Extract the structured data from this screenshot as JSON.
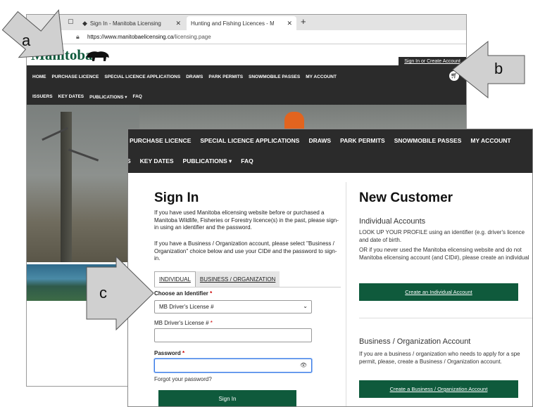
{
  "browser": {
    "tabs": [
      {
        "label": "Sign In - Manitoba Licensing",
        "active": false
      },
      {
        "label": "Hunting and Fishing Licences - M",
        "active": true
      }
    ],
    "url_host": "https://www.manitobaelicensing.ca",
    "url_path": "/licensing.page"
  },
  "site": {
    "logo_text": "Manitoba",
    "signin_link": "Sign In or Create Account",
    "nav_row1": [
      "HOME",
      "PURCHASE LICENCE",
      "SPECIAL LICENCE APPLICATIONS",
      "DRAWS",
      "PARK PERMITS",
      "SNOWMOBILE PASSES",
      "MY ACCOUNT"
    ],
    "nav_row2": [
      "ISSUERS",
      "KEY DATES",
      "PUBLICATIONS ▾",
      "FAQ"
    ]
  },
  "overlay": {
    "nav_row1": [
      "PURCHASE LICENCE",
      "SPECIAL LICENCE APPLICATIONS",
      "DRAWS",
      "PARK PERMITS",
      "SNOWMOBILE PASSES",
      "MY ACCOUNT"
    ],
    "nav_row2": [
      "S",
      "KEY DATES",
      "PUBLICATIONS ▾",
      "FAQ"
    ],
    "signin": {
      "title": "Sign In",
      "intro": "If you have used Manitoba elicensing website before or purchased a Manitoba Wildlife, Fisheries or Forestry licence(s) in the past, please sign-in using an identifier and the password.",
      "business_note": "If you have a Business / Organization account, please select \"Business / Organization\" choice below and use your CID# and the password to sign-in.",
      "tab_individual": "INDIVIDUAL",
      "tab_business": "BUSINESS / ORGANIZATION",
      "identifier_label": "Choose an Identifier",
      "identifier_value": "MB Driver's License #",
      "license_label": "MB Driver's License #",
      "password_label": "Password",
      "required_mark": "*",
      "forgot": "Forgot your password?",
      "button": "Sign In"
    },
    "new_customer": {
      "title": "New Customer",
      "individual_heading": "Individual Accounts",
      "individual_line1": "LOOK UP YOUR PROFILE using an identifier (e.g. driver's licence",
      "individual_line2": "and date of birth.",
      "individual_line3": "OR if you never used the Manitoba elicensing website and do not",
      "individual_line4": "Manitoba elicensing account (and CID#), please create an individual",
      "individual_button": "Create an Individual Account",
      "business_heading": "Business / Organization Account",
      "business_line1": "If you are a business / organization who needs to apply for a spe",
      "business_line2": "permit, please, create a Business / Organization account.",
      "business_button": "Create a Business / Organization Account"
    }
  },
  "callouts": {
    "a": "a",
    "b": "b",
    "c": "c"
  },
  "colors": {
    "brand_green": "#0f5a3c",
    "nav_dark": "#2b2b2b",
    "callout_fill": "#d0d0d0"
  }
}
